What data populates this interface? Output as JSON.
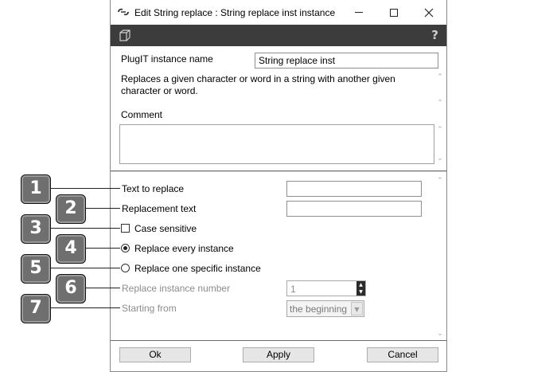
{
  "window": {
    "title": "Edit String replace : String replace inst instance",
    "help_glyph": "?"
  },
  "instance": {
    "name_label": "PlugIT instance name",
    "name_value": "String replace inst",
    "description": "Replaces a given character or word in a string with another given character or word.",
    "comment_label": "Comment",
    "comment_value": ""
  },
  "settings": {
    "text_to_replace_label": "Text to replace",
    "text_to_replace_value": "",
    "replacement_text_label": "Replacement text",
    "replacement_text_value": "",
    "case_sensitive_label": "Case sensitive",
    "case_sensitive_checked": false,
    "replace_every_label": "Replace every instance",
    "replace_every_selected": true,
    "replace_one_label": "Replace one specific instance",
    "replace_one_selected": false,
    "instance_number_label": "Replace instance number",
    "instance_number_value": "1",
    "starting_from_label": "Starting from",
    "starting_from_value": "the beginning"
  },
  "buttons": {
    "ok": "Ok",
    "apply": "Apply",
    "cancel": "Cancel"
  },
  "callouts": [
    "1",
    "2",
    "3",
    "4",
    "5",
    "6",
    "7"
  ],
  "colors": {
    "toolbar": "#3c3c3c",
    "badge": "#6f6f6f",
    "disabled_text": "#8c8c8c"
  }
}
